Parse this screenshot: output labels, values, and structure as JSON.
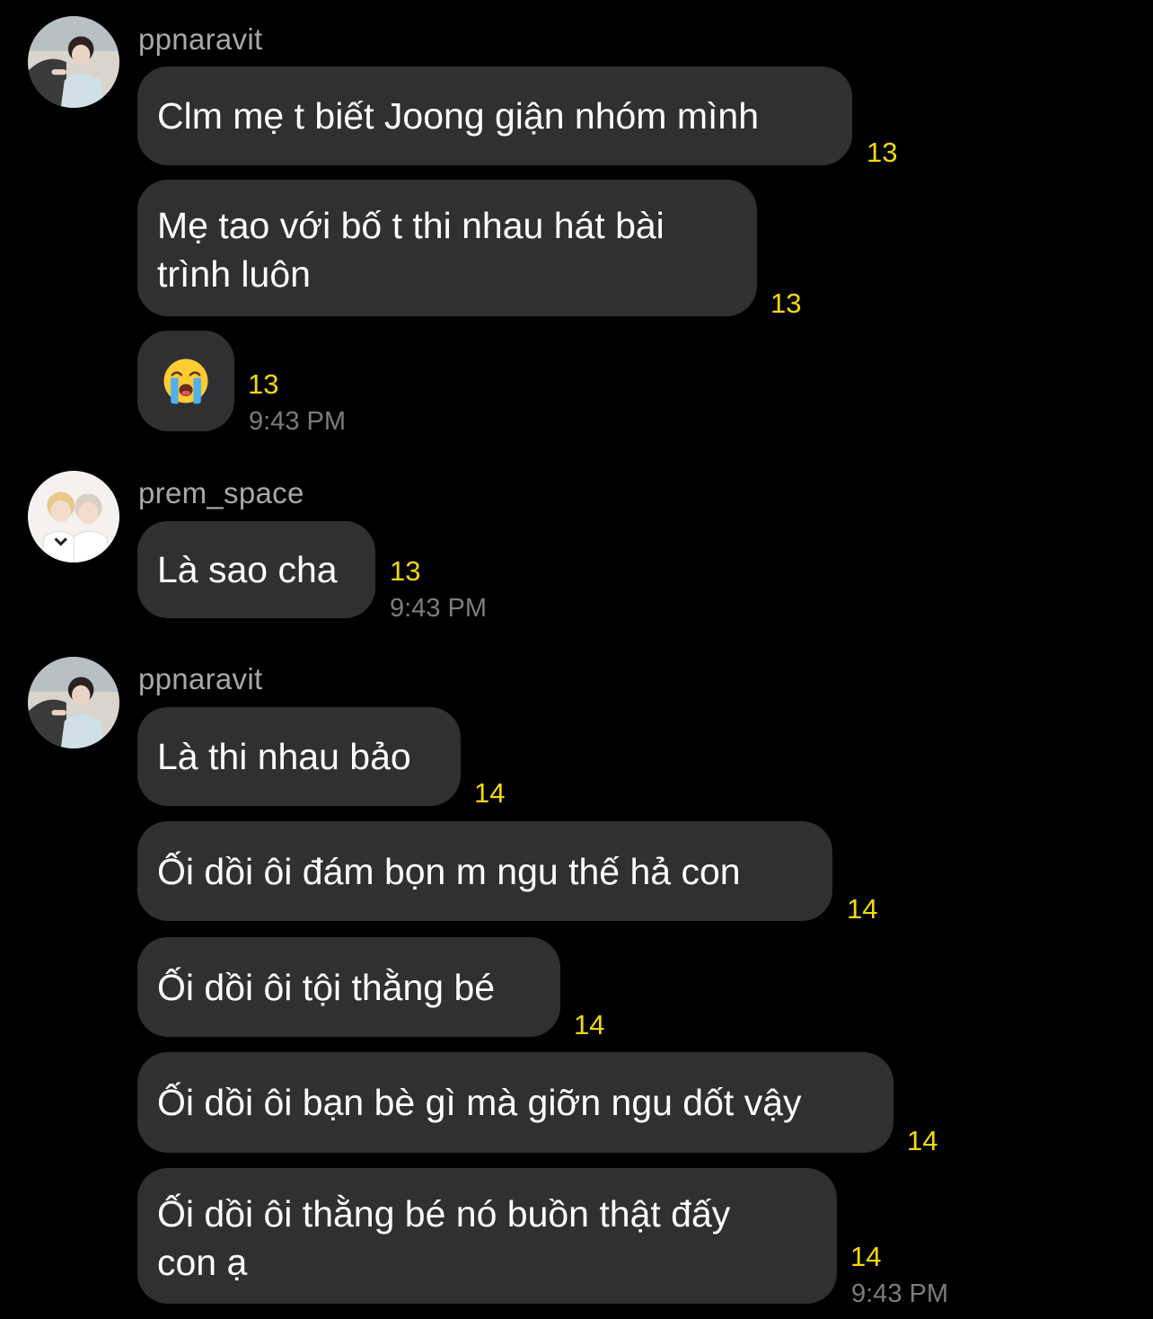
{
  "colors": {
    "background": "#000000",
    "bubble": "#303033",
    "username": "#a8a8a8",
    "read_count": "#f5d90a",
    "timestamp": "#7c7c80"
  },
  "groups": [
    {
      "username": "ppnaravit",
      "avatar_icon": "profile-photo-avatar",
      "messages": [
        {
          "text": "Clm mẹ t biết Joong giận nhóm mình",
          "count": "13"
        },
        {
          "text": "Mẹ tao với bố t thi nhau hát bài\ntrình luôn",
          "count": "13"
        },
        {
          "emoji": "loudly-crying-face-emoji",
          "count": "13"
        }
      ],
      "time": "9:43 PM"
    },
    {
      "username": "prem_space",
      "avatar_icon": "profile-photo-avatar",
      "messages": [
        {
          "text": "Là sao cha",
          "count": "13"
        }
      ],
      "time": "9:43 PM"
    },
    {
      "username": "ppnaravit",
      "avatar_icon": "profile-photo-avatar",
      "messages": [
        {
          "text": "Là thi nhau bảo",
          "count": "14"
        },
        {
          "text": "Ối dồi ôi đám bọn m ngu thế hả con",
          "count": "14"
        },
        {
          "text": "Ối dồi ôi tội thằng bé",
          "count": "14"
        },
        {
          "text": "Ối dồi ôi bạn bè gì mà giỡn ngu dốt vậy",
          "count": "14"
        },
        {
          "text": "Ối dồi ôi thằng bé nó buồn thật đấy\ncon ạ",
          "count": "14"
        }
      ],
      "time": "9:43 PM"
    }
  ]
}
